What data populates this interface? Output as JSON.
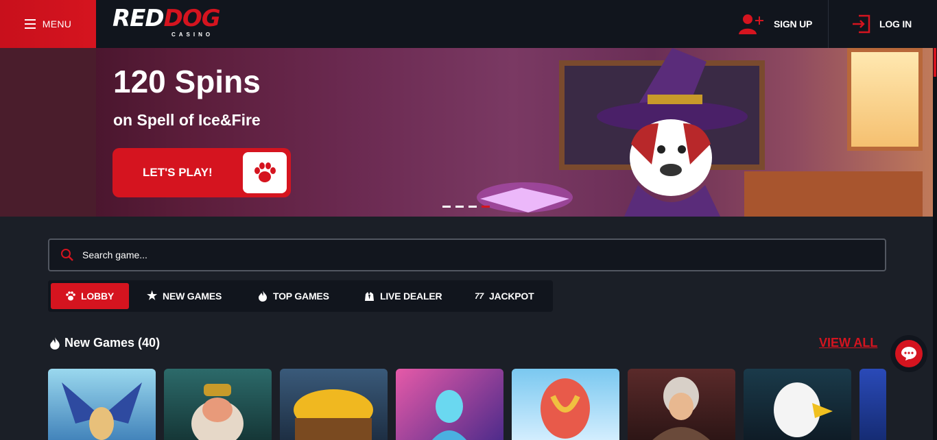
{
  "header": {
    "menu_label": "MENU",
    "logo": {
      "red": "RED",
      "dog": "DOG",
      "sub": "CASINO"
    },
    "signup_label": "SIGN UP",
    "login_label": "LOG IN"
  },
  "hero": {
    "title": "120 Spins",
    "subtitle": "on Spell of Ice&Fire",
    "cta_label": "LET'S PLAY!",
    "slides": 4,
    "active_slide": 4
  },
  "search": {
    "placeholder": "Search game..."
  },
  "tabs": [
    {
      "label": "LOBBY",
      "icon": "paw-icon",
      "active": true
    },
    {
      "label": "NEW GAMES",
      "icon": "star-icon"
    },
    {
      "label": "TOP GAMES",
      "icon": "flame-icon"
    },
    {
      "label": "LIVE DEALER",
      "icon": "dealer-icon"
    },
    {
      "label": "JACKPOT",
      "icon": "sevens-icon"
    }
  ],
  "section": {
    "title": "New Games (40)",
    "view_all": "VIEW ALL"
  },
  "colors": {
    "accent": "#d5141f",
    "header_bg": "#11151d",
    "page_bg": "#1b1f27"
  }
}
